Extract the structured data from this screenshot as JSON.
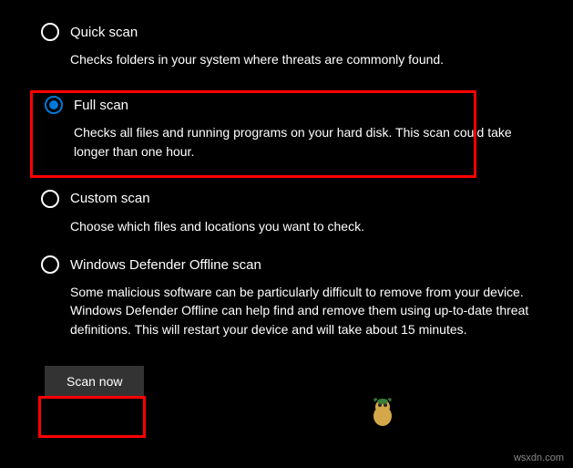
{
  "options": {
    "quick": {
      "title": "Quick scan",
      "desc": "Checks folders in your system where threats are commonly found."
    },
    "full": {
      "title": "Full scan",
      "desc": "Checks all files and running programs on your hard disk. This scan could take longer than one hour."
    },
    "custom": {
      "title": "Custom scan",
      "desc": "Choose which files and locations you want to check."
    },
    "offline": {
      "title": "Windows Defender Offline scan",
      "desc": "Some malicious software can be particularly difficult to remove from your device. Windows Defender Offline can help find and remove them using up-to-date threat definitions. This will restart your device and will take about 15 minutes."
    }
  },
  "button": {
    "scan_now": "Scan now"
  },
  "watermark": "wsxdn.com"
}
